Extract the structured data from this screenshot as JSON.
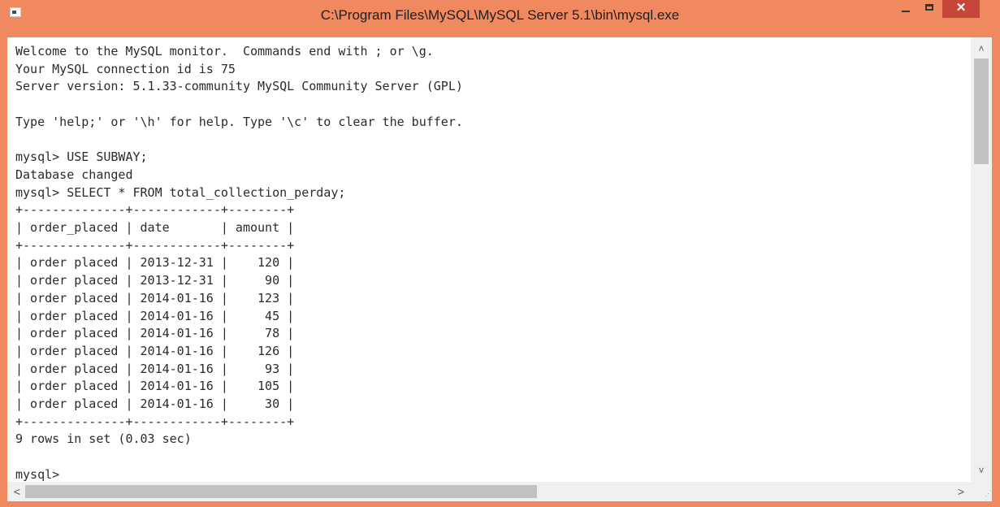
{
  "window": {
    "title": "C:\\Program Files\\MySQL\\MySQL Server 5.1\\bin\\mysql.exe",
    "minimize_label": "",
    "maximize_label": "",
    "close_label": "✕"
  },
  "console": {
    "lines": [
      "Welcome to the MySQL monitor.  Commands end with ; or \\g.",
      "Your MySQL connection id is 75",
      "Server version: 5.1.33-community MySQL Community Server (GPL)",
      "",
      "Type 'help;' or '\\h' for help. Type '\\c' to clear the buffer.",
      "",
      "mysql> USE SUBWAY;",
      "Database changed",
      "mysql> SELECT * FROM total_collection_perday;",
      "+--------------+------------+--------+",
      "| order_placed | date       | amount |",
      "+--------------+------------+--------+",
      "| order placed | 2013-12-31 |    120 |",
      "| order placed | 2013-12-31 |     90 |",
      "| order placed | 2014-01-16 |    123 |",
      "| order placed | 2014-01-16 |     45 |",
      "| order placed | 2014-01-16 |     78 |",
      "| order placed | 2014-01-16 |    126 |",
      "| order placed | 2014-01-16 |     93 |",
      "| order placed | 2014-01-16 |    105 |",
      "| order placed | 2014-01-16 |     30 |",
      "+--------------+------------+--------+",
      "9 rows in set (0.03 sec)",
      "",
      "mysql> "
    ]
  },
  "scrollbars": {
    "up_arrow": "˄",
    "down_arrow": "˅",
    "left_arrow": "<",
    "right_arrow": ">",
    "grip": "⋰"
  }
}
